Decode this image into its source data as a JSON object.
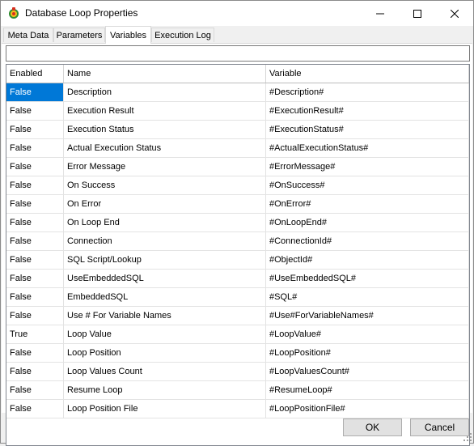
{
  "window": {
    "title": "Database Loop Properties",
    "icon": "database-loop-app-icon"
  },
  "tabs": [
    {
      "label": "Meta Data",
      "active": false
    },
    {
      "label": "Parameters",
      "active": false
    },
    {
      "label": "Variables",
      "active": true
    },
    {
      "label": "Execution Log",
      "active": false
    }
  ],
  "filter": {
    "value": "",
    "placeholder": ""
  },
  "grid": {
    "headers": {
      "enabled": "Enabled",
      "name": "Name",
      "variable": "Variable"
    },
    "rows": [
      {
        "enabled": "False",
        "name": "Description",
        "variable": "#Description#"
      },
      {
        "enabled": "False",
        "name": "Execution Result",
        "variable": "#ExecutionResult#"
      },
      {
        "enabled": "False",
        "name": "Execution Status",
        "variable": "#ExecutionStatus#"
      },
      {
        "enabled": "False",
        "name": "Actual Execution Status",
        "variable": "#ActualExecutionStatus#"
      },
      {
        "enabled": "False",
        "name": "Error Message",
        "variable": "#ErrorMessage#"
      },
      {
        "enabled": "False",
        "name": "On Success",
        "variable": "#OnSuccess#"
      },
      {
        "enabled": "False",
        "name": "On Error",
        "variable": "#OnError#"
      },
      {
        "enabled": "False",
        "name": "On Loop End",
        "variable": "#OnLoopEnd#"
      },
      {
        "enabled": "False",
        "name": "Connection",
        "variable": "#ConnectionId#"
      },
      {
        "enabled": "False",
        "name": "SQL Script/Lookup",
        "variable": "#ObjectId#"
      },
      {
        "enabled": "False",
        "name": "UseEmbeddedSQL",
        "variable": "#UseEmbeddedSQL#"
      },
      {
        "enabled": "False",
        "name": "EmbeddedSQL",
        "variable": "#SQL#"
      },
      {
        "enabled": "False",
        "name": "Use # For Variable Names",
        "variable": "#Use#ForVariableNames#"
      },
      {
        "enabled": "True",
        "name": "Loop Value",
        "variable": "#LoopValue#"
      },
      {
        "enabled": "False",
        "name": "Loop Position",
        "variable": "#LoopPosition#"
      },
      {
        "enabled": "False",
        "name": "Loop Values Count",
        "variable": "#LoopValuesCount#"
      },
      {
        "enabled": "False",
        "name": "Resume Loop",
        "variable": "#ResumeLoop#"
      },
      {
        "enabled": "False",
        "name": "Loop Position File",
        "variable": "#LoopPositionFile#"
      }
    ]
  },
  "buttons": {
    "ok": "OK",
    "cancel": "Cancel"
  },
  "colors": {
    "selection": "#0078d7",
    "window_bg": "#f0f0f0"
  }
}
